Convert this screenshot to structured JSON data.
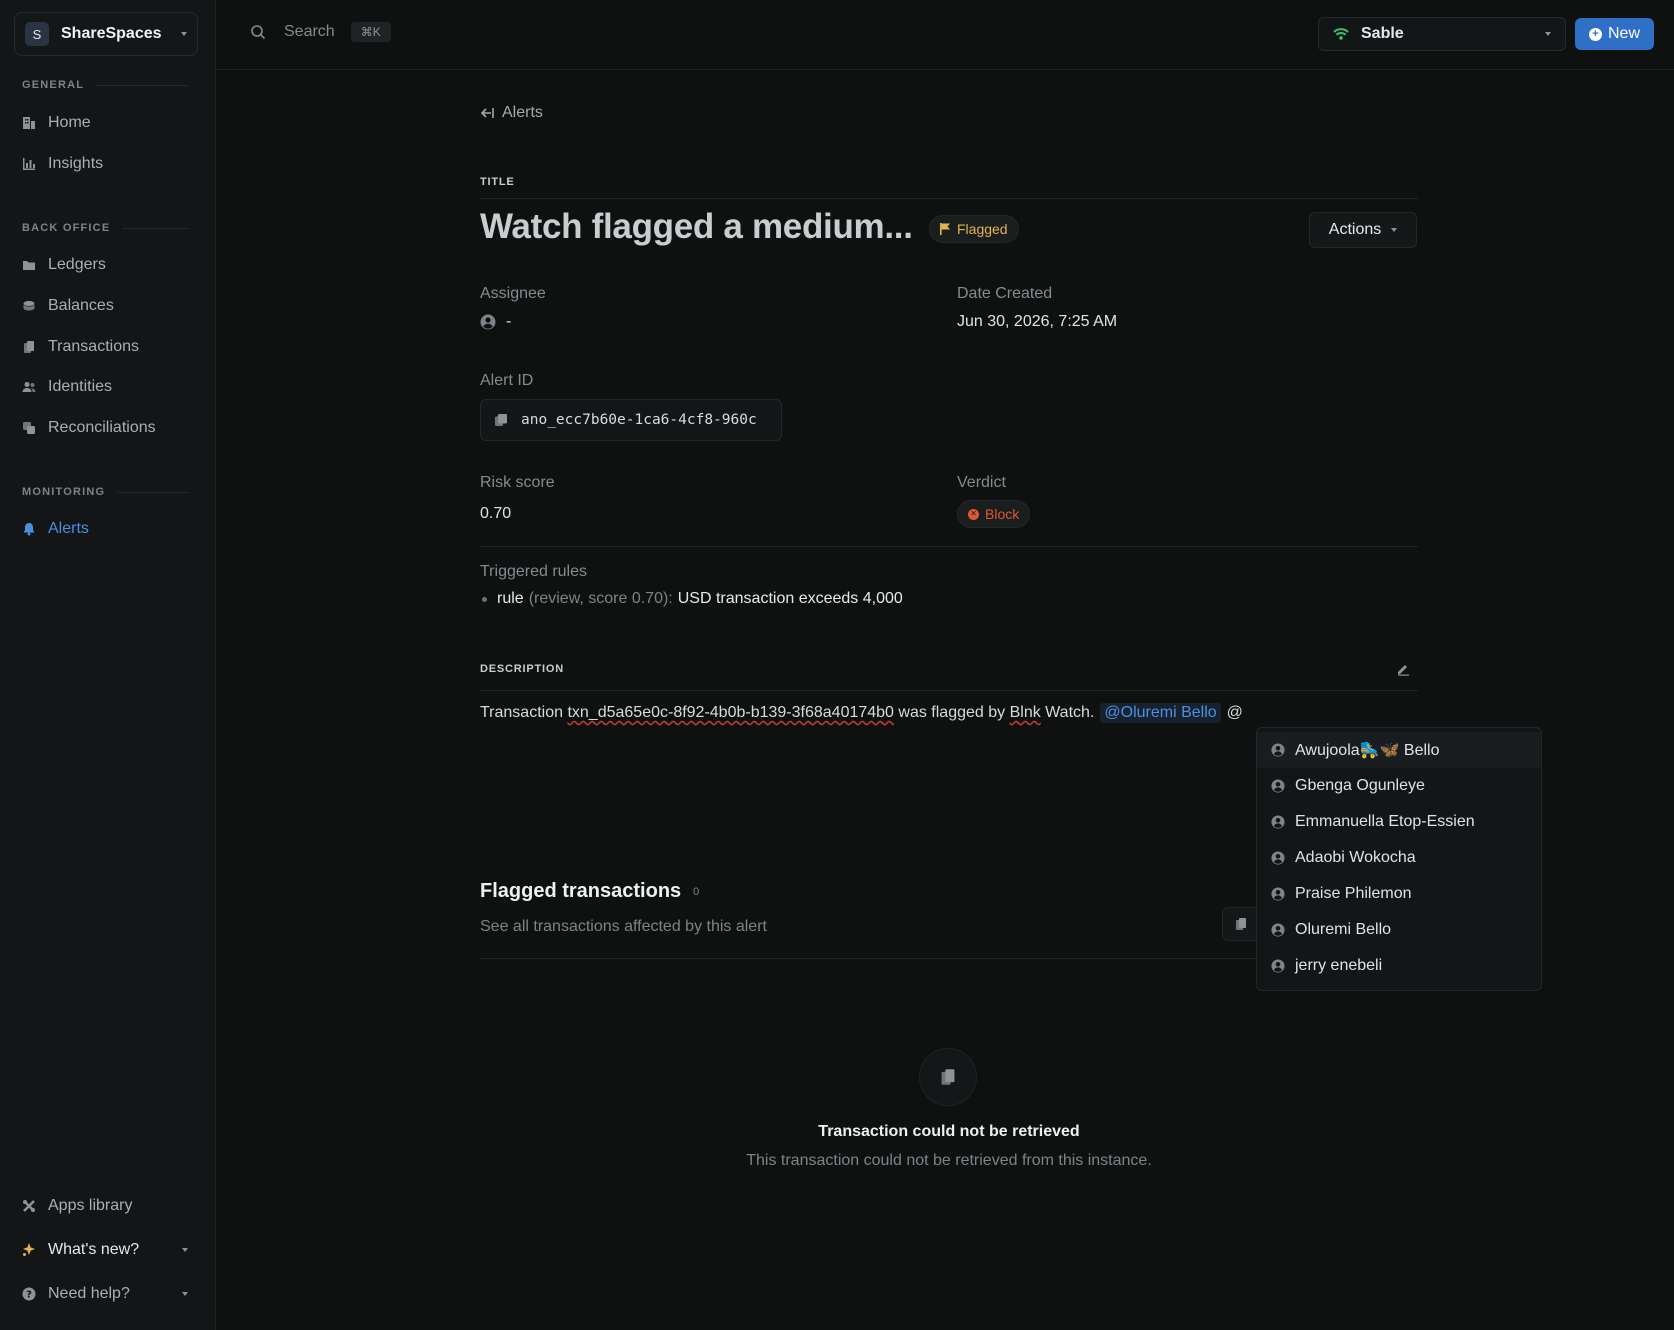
{
  "workspace": {
    "initial": "S",
    "name": "ShareSpaces"
  },
  "sidebar": {
    "sections": [
      {
        "label": "GENERAL"
      },
      {
        "label": "BACK OFFICE"
      },
      {
        "label": "MONITORING"
      }
    ],
    "items": [
      {
        "label": "Home",
        "icon": "building-icon"
      },
      {
        "label": "Insights",
        "icon": "bar-chart-icon"
      },
      {
        "label": "Ledgers",
        "icon": "folder-icon"
      },
      {
        "label": "Balances",
        "icon": "coins-icon"
      },
      {
        "label": "Transactions",
        "icon": "receipt-icon"
      },
      {
        "label": "Identities",
        "icon": "users-icon"
      },
      {
        "label": "Reconciliations",
        "icon": "copy-icon"
      },
      {
        "label": "Alerts",
        "icon": "bell-icon",
        "active": true
      }
    ],
    "bottom": [
      {
        "label": "Apps library",
        "icon": "puzzle-icon"
      },
      {
        "label": "What's new?",
        "icon": "sparkle-icon"
      },
      {
        "label": "Need help?",
        "icon": "help-icon"
      }
    ]
  },
  "topbar": {
    "search_placeholder": "Search",
    "search_shortcut": "⌘K",
    "environment": "Sable",
    "new_label": "New"
  },
  "alert": {
    "back_label": "Alerts",
    "title_caption": "TITLE",
    "title": "Watch flagged a medium...",
    "status": "Flagged",
    "actions_label": "Actions",
    "assignee_label": "Assignee",
    "assignee_value": "-",
    "date_label": "Date Created",
    "date_value": "Jun 30, 2026, 7:25 AM",
    "alert_id_label": "Alert ID",
    "alert_id_value": "ano_ecc7b60e-1ca6-4cf8-960c",
    "risk_label": "Risk score",
    "risk_value": "0.70",
    "verdict_label": "Verdict",
    "verdict_value": "Block",
    "rules_label": "Triggered rules",
    "rules": [
      {
        "name": "rule",
        "meta": "(review, score 0.70):",
        "desc": "USD transaction exceeds 4,000"
      }
    ],
    "description_caption": "DESCRIPTION",
    "description": {
      "prefix": "Transaction",
      "txn": "txn_d5a65e0c-8f92-4b0b-b139-3f68a40174b0",
      "middle": "was flagged by",
      "brand": "Blnk",
      "suffix": "Watch.",
      "mention": "@Oluremi Bello",
      "cursor": "@"
    }
  },
  "flagged": {
    "title": "Flagged transactions",
    "count": "0",
    "subtitle": "See all transactions affected by this alert",
    "empty_title": "Transaction could not be retrieved",
    "empty_subtitle": "This transaction could not be retrieved from this instance."
  },
  "mention_suggestions": [
    "Awujoola🛼🦋 Bello",
    "Gbenga Ogunleye",
    "Emmanuella Etop-Essien",
    "Adaobi Wokocha",
    "Praise Philemon",
    "Oluremi Bello",
    "jerry enebeli"
  ],
  "colors": {
    "accent": "#2f6fc6",
    "link": "#4b8fe0",
    "flag": "#e0b54a",
    "block": "#e2572f"
  }
}
